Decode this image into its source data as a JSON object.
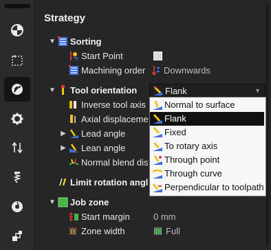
{
  "sidebar": {
    "items": [
      {
        "icon": "shading-ball-icon"
      },
      {
        "icon": "selection-box-icon"
      },
      {
        "icon": "strategy-icon",
        "active": true
      },
      {
        "icon": "gear-icon"
      },
      {
        "icon": "transform-arrows-icon"
      },
      {
        "icon": "tool-icon"
      },
      {
        "icon": "disc-icon"
      },
      {
        "icon": "layers-icon"
      }
    ]
  },
  "panel": {
    "title": "Strategy",
    "sorting": {
      "label": "Sorting",
      "start_point": {
        "label": "Start Point"
      },
      "machining_order": {
        "label": "Machining order",
        "value": "Downwards"
      }
    },
    "tool_orientation": {
      "label": "Tool orientation",
      "value": "Flank",
      "children": {
        "inverse_tool_axis": "Inverse tool axis",
        "axial_displacement": "Axial displacement",
        "lead_angle": "Lead angle",
        "lean_angle": "Lean angle",
        "normal_blend": "Normal blend distance"
      }
    },
    "limit_rotation": {
      "label": "Limit rotation angles"
    },
    "job_zone": {
      "label": "Job zone",
      "start_margin": {
        "label": "Start margin",
        "value": "0 mm"
      },
      "zone_width": {
        "label": "Zone width",
        "value": "Full"
      }
    }
  },
  "dropdown": {
    "options": [
      {
        "label": "Normal to surface",
        "selected": false
      },
      {
        "label": "Flank",
        "selected": true
      },
      {
        "label": "Fixed",
        "selected": false
      },
      {
        "label": "To rotary axis",
        "selected": false
      },
      {
        "label": "Through point",
        "selected": false
      },
      {
        "label": "Through curve",
        "selected": false
      },
      {
        "label": "Perpendicular to toolpath",
        "selected": false
      }
    ]
  },
  "colors": {
    "background": "#262626",
    "sidebar": "#2b2b2b",
    "accent_yellow": "#f0c419",
    "icon_blue": "#3f6fe0",
    "icon_red": "#d83a3a",
    "icon_green": "#46b54a"
  }
}
